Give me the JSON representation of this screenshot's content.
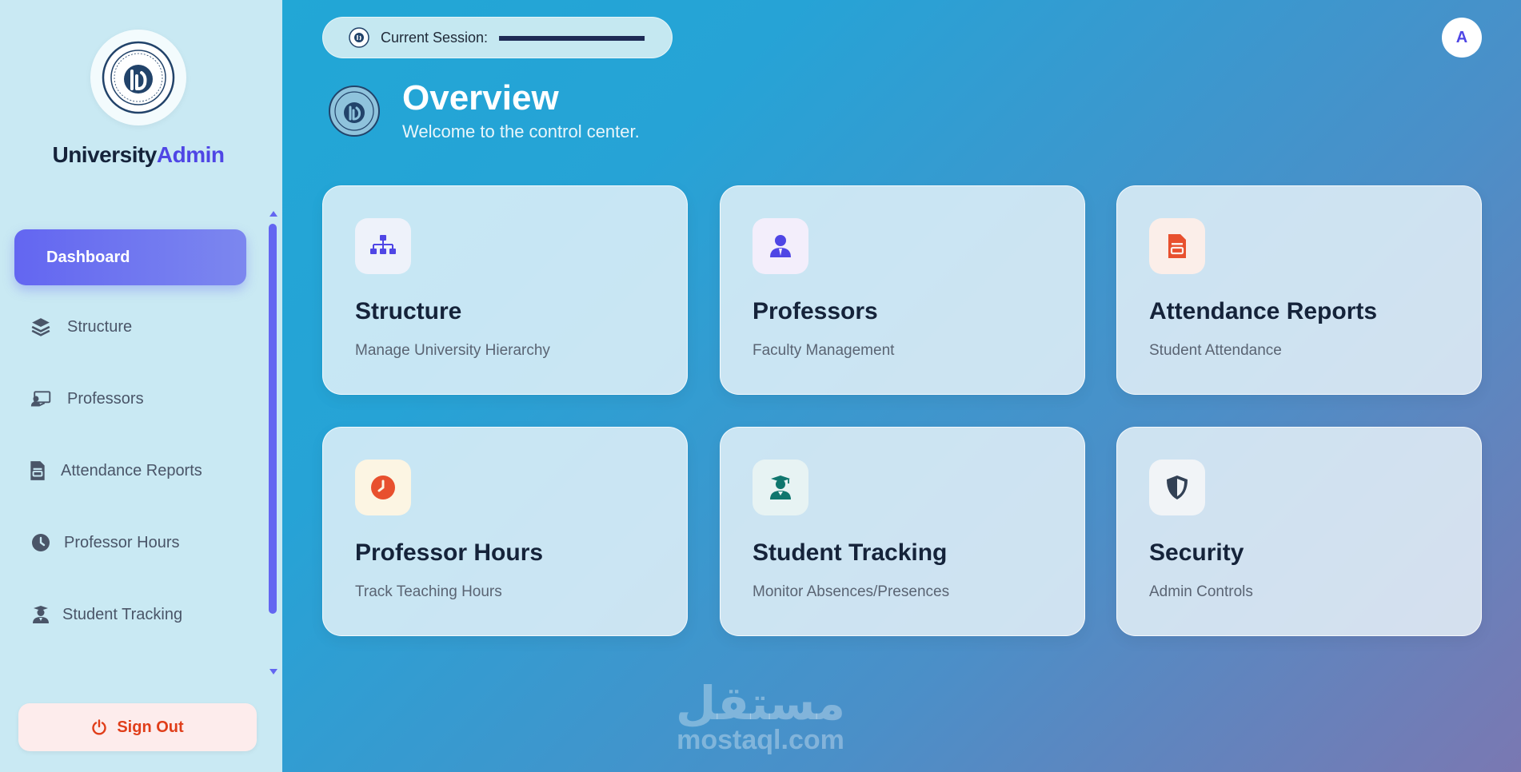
{
  "brand": {
    "part1": "University",
    "part2": "Admin",
    "part2_color": "#4f46e5"
  },
  "sidebar": {
    "items": [
      {
        "label": "Dashboard",
        "icon": "none",
        "active": true
      },
      {
        "label": "Structure",
        "icon": "layers-icon"
      },
      {
        "label": "Professors",
        "icon": "chalkboard-teacher-icon"
      },
      {
        "label": "Attendance Reports",
        "icon": "file-report-icon"
      },
      {
        "label": "Professor Hours",
        "icon": "clock-icon"
      },
      {
        "label": "Student Tracking",
        "icon": "user-graduate-icon"
      }
    ],
    "signout_label": "Sign Out"
  },
  "header": {
    "session_label": "Current Session:",
    "session_value": "",
    "avatar_initial": "A"
  },
  "overview": {
    "title": "Overview",
    "subtitle": "Welcome to the control center."
  },
  "cards": [
    {
      "title": "Structure",
      "subtitle": "Manage University Hierarchy",
      "icon": "sitemap-icon",
      "color": "#4f46e5"
    },
    {
      "title": "Professors",
      "subtitle": "Faculty Management",
      "icon": "user-tie-icon",
      "color": "#4f46e5"
    },
    {
      "title": "Attendance Reports",
      "subtitle": "Student Attendance",
      "icon": "file-report-icon",
      "color": "#e8502e"
    },
    {
      "title": "Professor Hours",
      "subtitle": "Track Teaching Hours",
      "icon": "clock-icon",
      "color": "#e8502e"
    },
    {
      "title": "Student Tracking",
      "subtitle": "Monitor Absences/Presences",
      "icon": "user-graduate-icon",
      "color": "#0f766e"
    },
    {
      "title": "Security",
      "subtitle": "Admin Controls",
      "icon": "shield-icon",
      "color": "#334155"
    }
  ],
  "watermark": {
    "arabic": "مستقل",
    "latin": "mostaql.com"
  },
  "colors": {
    "accent": "#6366f1",
    "danger": "#e03e1a",
    "sidebar_bg": "#c9e9f3"
  }
}
